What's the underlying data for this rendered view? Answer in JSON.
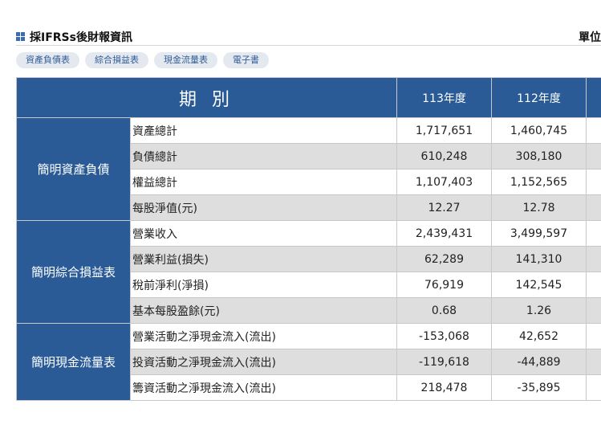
{
  "header": {
    "title": "採IFRSs後財報資訊",
    "unit_label": "單位"
  },
  "tabs": [
    {
      "label": "資產負債表"
    },
    {
      "label": "綜合損益表"
    },
    {
      "label": "現金流量表"
    },
    {
      "label": "電子書"
    }
  ],
  "table": {
    "period_header": "期 別",
    "years": [
      "113年度",
      "112年度"
    ],
    "groups": [
      {
        "category": "簡明資產負債",
        "rows": [
          {
            "label": "資產總計",
            "values": [
              "1,717,651",
              "1,460,745"
            ]
          },
          {
            "label": "負債總計",
            "values": [
              "610,248",
              "308,180"
            ]
          },
          {
            "label": "權益總計",
            "values": [
              "1,107,403",
              "1,152,565"
            ]
          },
          {
            "label": "每股淨值(元)",
            "values": [
              "12.27",
              "12.78"
            ]
          }
        ]
      },
      {
        "category": "簡明綜合損益表",
        "rows": [
          {
            "label": "營業收入",
            "values": [
              "2,439,431",
              "3,499,597"
            ]
          },
          {
            "label": "營業利益(損失)",
            "values": [
              "62,289",
              "141,310"
            ]
          },
          {
            "label": "稅前淨利(淨損)",
            "values": [
              "76,919",
              "142,545"
            ]
          },
          {
            "label": "基本每股盈餘(元)",
            "values": [
              "0.68",
              "1.26"
            ]
          }
        ]
      },
      {
        "category": "簡明現金流量表",
        "rows": [
          {
            "label": "營業活動之淨現金流入(流出)",
            "values": [
              "-153,068",
              "42,652"
            ]
          },
          {
            "label": "投資活動之淨現金流入(流出)",
            "values": [
              "-119,618",
              "-44,889"
            ]
          },
          {
            "label": "籌資活動之淨現金流入(流出)",
            "values": [
              "218,478",
              "-35,895"
            ]
          }
        ]
      }
    ]
  }
}
